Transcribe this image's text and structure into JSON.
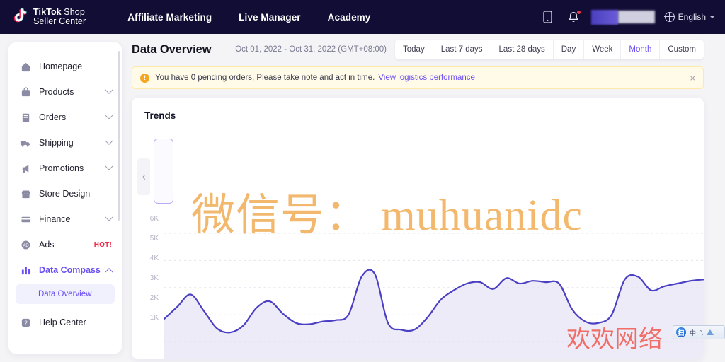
{
  "brand": {
    "line1_bold": "TikTok",
    "line1_thin": " Shop",
    "line2": "Seller Center",
    "logo_icon": "tiktok-note-icon"
  },
  "topnav": {
    "links": [
      {
        "label": "Affiliate Marketing"
      },
      {
        "label": "Live Manager"
      },
      {
        "label": "Academy"
      }
    ],
    "mobile_icon": "mobile-phone-icon",
    "bell_icon": "bell-icon",
    "has_notification_dot": true,
    "language": {
      "label": "English",
      "icon": "globe-icon",
      "caret": "chevron-down-icon"
    },
    "account_redacted": true
  },
  "sidebar": {
    "items": [
      {
        "label": "Homepage",
        "icon": "home-icon",
        "expandable": false,
        "active": false
      },
      {
        "label": "Products",
        "icon": "bag-icon",
        "expandable": true,
        "active": false
      },
      {
        "label": "Orders",
        "icon": "order-list-icon",
        "expandable": true,
        "active": false
      },
      {
        "label": "Shipping",
        "icon": "truck-icon",
        "expandable": true,
        "active": false
      },
      {
        "label": "Promotions",
        "icon": "megaphone-icon",
        "expandable": true,
        "active": false
      },
      {
        "label": "Store Design",
        "icon": "storefront-icon",
        "expandable": false,
        "active": false
      },
      {
        "label": "Finance",
        "icon": "card-icon",
        "expandable": true,
        "active": false
      },
      {
        "label": "Ads",
        "icon": "ads-icon",
        "expandable": false,
        "active": false,
        "badge": "HOT!"
      },
      {
        "label": "Data Compass",
        "icon": "bar-chart-icon",
        "expandable": true,
        "active": true,
        "expanded": true
      },
      {
        "label": "Help Center",
        "icon": "help-icon",
        "expandable": false,
        "active": false
      }
    ],
    "sub_item": {
      "label": "Data Overview",
      "active": true
    }
  },
  "page": {
    "title": "Data Overview",
    "date_range": "Oct 01, 2022 - Oct 31, 2022 (GMT+08:00)",
    "range_buttons": [
      {
        "label": "Today",
        "selected": false
      },
      {
        "label": "Last 7 days",
        "selected": false
      },
      {
        "label": "Last 28 days",
        "selected": false
      },
      {
        "label": "Day",
        "selected": false
      },
      {
        "label": "Week",
        "selected": false
      },
      {
        "label": "Month",
        "selected": true
      },
      {
        "label": "Custom",
        "selected": false
      }
    ]
  },
  "banner": {
    "icon": "warning-icon",
    "icon_glyph": "!",
    "text": "You have 0 pending orders, Please take note and act in time.",
    "link_label": "View logistics performance",
    "close_label": "×"
  },
  "trends_card": {
    "title": "Trends",
    "scroll_left_icon": "chevron-left-icon",
    "selected_metric_card": true
  },
  "watermarks": {
    "orange": "微信号： muhuanidc",
    "red": "欢欢网络",
    "ime_label": "中",
    "ime_badge": "扫"
  },
  "colors": {
    "nav_bg": "#120d35",
    "accent": "#6a4df4",
    "line": "#4b3fc4",
    "area": "#e7e5f7",
    "warn": "#f5a623",
    "hot": "#f0294a",
    "watermark_orange": "#f0a94e",
    "watermark_red": "#f2584f"
  },
  "chart_data": {
    "type": "area",
    "title": "Trends",
    "xlabel": "",
    "ylabel": "",
    "ytick_labels": [
      "1K",
      "2K",
      "3K",
      "4K",
      "5K",
      "6K"
    ],
    "ytick_values": [
      1000,
      2000,
      3000,
      4000,
      5000,
      6000
    ],
    "ylim": [
      0,
      6500
    ],
    "grid": true,
    "legend": "none",
    "series": [
      {
        "name": "Trend",
        "values": [
          1850,
          2300,
          2750,
          2150,
          1500,
          1350,
          1600,
          2250,
          2500,
          2050,
          1700,
          1650,
          1750,
          1800,
          2000,
          3400,
          3500,
          1700,
          1450,
          1450,
          1900,
          2550,
          2900,
          3150,
          3200,
          2950,
          3350,
          3150,
          3250,
          3200,
          3150,
          2200,
          1750,
          1700,
          2000,
          3300,
          3400,
          2900,
          3050,
          3150,
          3250,
          3300
        ]
      }
    ]
  }
}
